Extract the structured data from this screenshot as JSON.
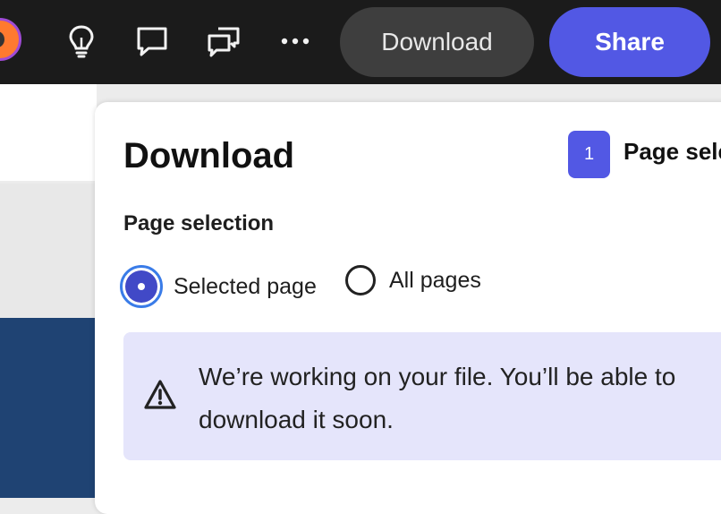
{
  "toolbar": {
    "avatar_icon": "user-avatar-icon",
    "icons": [
      "lightbulb-icon",
      "comment-icon",
      "comments-icon",
      "more-icon"
    ],
    "download_label": "Download",
    "share_label": "Share",
    "share_color": "#5258e4"
  },
  "panel": {
    "title": "Download",
    "step_number": "1",
    "step_label": "Page sele",
    "section_label": "Page selection",
    "radio_options": [
      {
        "label": "Selected page",
        "selected": true
      },
      {
        "label": "All pages",
        "selected": false
      }
    ],
    "notice_icon": "warning-icon",
    "notice_text": "We’re working on your file. You’ll be able to download it soon."
  }
}
